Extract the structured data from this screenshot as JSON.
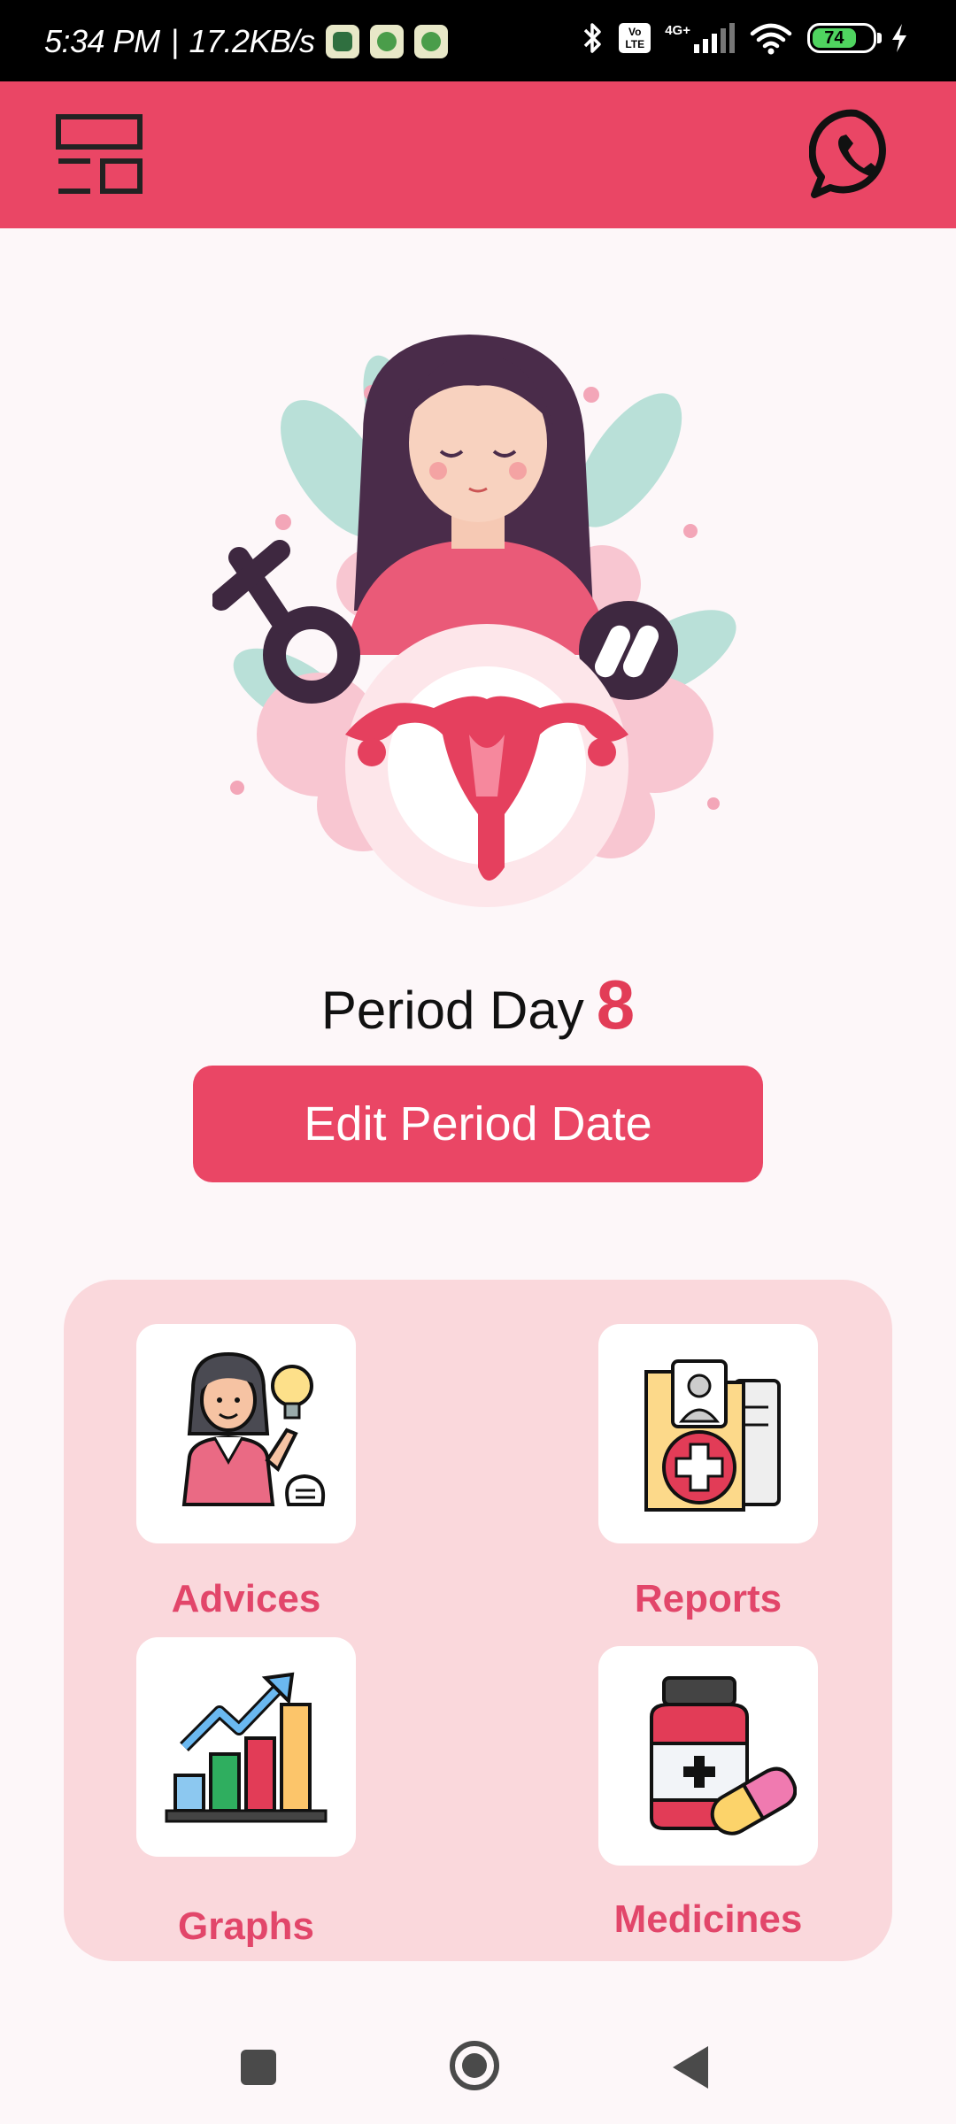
{
  "status_bar": {
    "time": "5:34 PM",
    "separator": "|",
    "net_speed": "17.2KB/s",
    "volte_text": "Vo LTE",
    "network_type": "4G+",
    "battery_level": "74"
  },
  "app_bar": {
    "menu_icon": "dashboard-menu-icon",
    "whatsapp_icon": "whatsapp-icon",
    "color": "#ea4665"
  },
  "period": {
    "label": "Period Day",
    "day": "8"
  },
  "edit_button": {
    "label": "Edit Period Date"
  },
  "menu": {
    "items": [
      {
        "label": "Advices",
        "icon": "advice-woman-lightbulb-icon"
      },
      {
        "label": "Reports",
        "icon": "medical-report-folder-icon"
      },
      {
        "label": "Graphs",
        "icon": "bar-graph-trend-icon"
      },
      {
        "label": "Medicines",
        "icon": "medicine-bottle-capsule-icon"
      }
    ]
  },
  "colors": {
    "accent": "#ea4665",
    "panel": "#fad8dc",
    "label": "#e2466a",
    "background": "#fdf7f9"
  }
}
